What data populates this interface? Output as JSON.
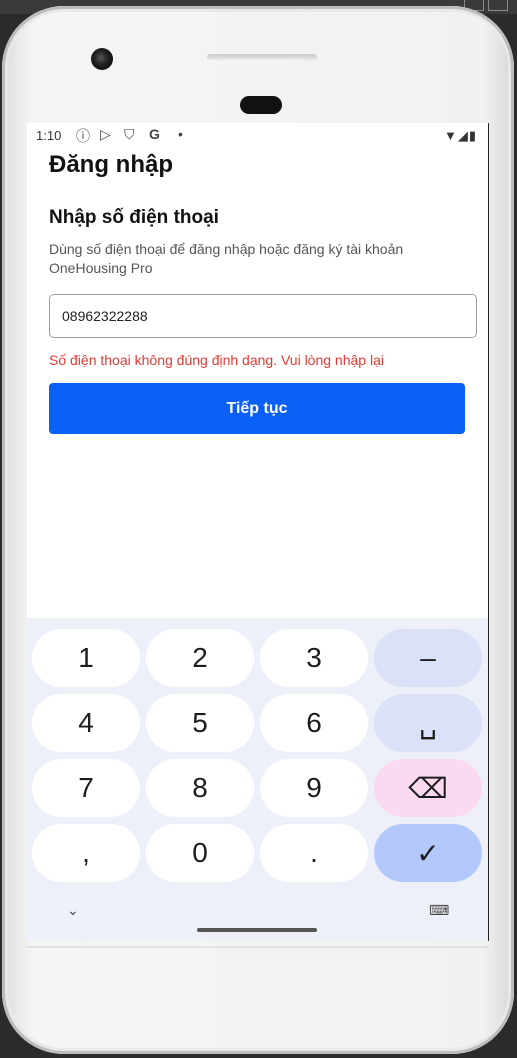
{
  "status_bar": {
    "time": "1:10",
    "icons": [
      "info-icon",
      "play-store-icon",
      "shield-icon",
      "google-icon",
      "dot-icon"
    ],
    "right_icons": [
      "wifi-icon",
      "signal-icon",
      "battery-icon"
    ]
  },
  "page": {
    "title": "Đăng nhập",
    "section_title": "Nhập số điện thoại",
    "description": "Dùng số điện thoại để đăng nhập hoặc đăng ký tài khoản OneHousing Pro",
    "phone_value": "08962322288",
    "error": "Số điện thoại không đúng định dạng. Vui lòng nhập lại",
    "continue_label": "Tiếp tục"
  },
  "keyboard": {
    "keys": [
      "1",
      "2",
      "3",
      "–",
      "4",
      "5",
      "6",
      "␣",
      "7",
      "8",
      "9",
      "⌫",
      ",",
      "0",
      ".",
      "✓"
    ],
    "nav_left": "⌄",
    "nav_right": "⌨"
  },
  "colors": {
    "primary": "#0a5ff5",
    "error": "#e53935",
    "key_function": "#dbe1f6",
    "key_delete": "#fbd9f1",
    "key_done": "#b3c8fb"
  }
}
